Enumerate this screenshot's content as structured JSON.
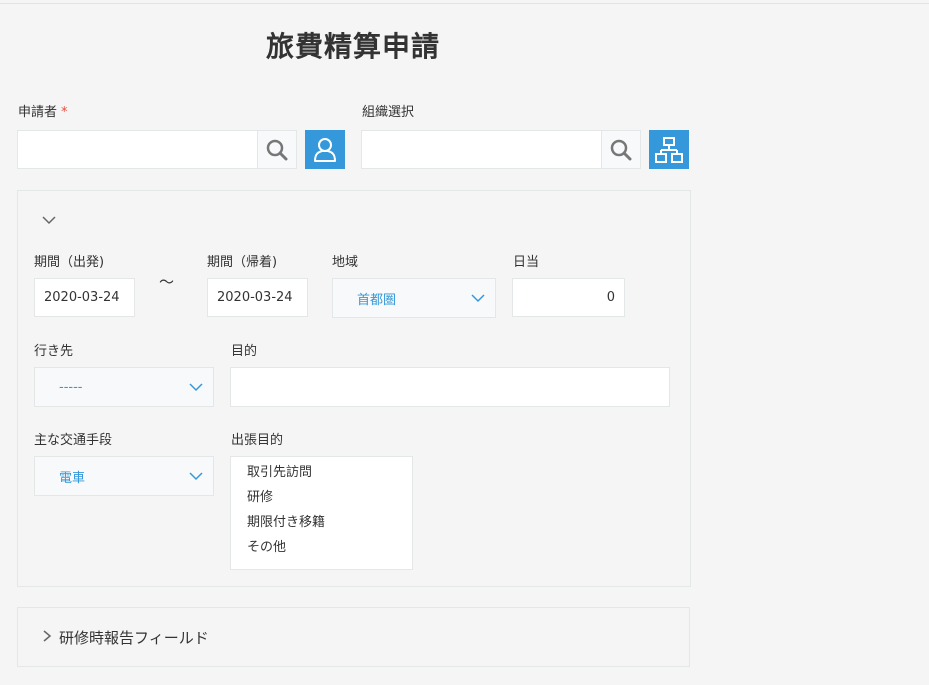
{
  "form": {
    "title": "旅費精算申請"
  },
  "applicant": {
    "label": "申請者",
    "required_mark": "*",
    "value": ""
  },
  "org": {
    "label": "組織選択",
    "value": ""
  },
  "group": {
    "period_start": {
      "label": "期間（出発)",
      "value": "2020-03-24"
    },
    "tilde": "～",
    "period_end": {
      "label": "期間（帰着)",
      "value": "2020-03-24"
    },
    "region": {
      "label": "地域",
      "value": "首都圏"
    },
    "allowance": {
      "label": "日当",
      "value": "0"
    },
    "destination": {
      "label": "行き先",
      "value": "-----"
    },
    "purpose": {
      "label": "目的",
      "value": ""
    },
    "transport": {
      "label": "主な交通手段",
      "value": "電車"
    },
    "trip_purpose": {
      "label": "出張目的",
      "options": [
        "取引先訪問",
        "研修",
        "期限付き移籍",
        "その他"
      ]
    }
  },
  "training_group": {
    "label": "研修時報告フィールド"
  },
  "colors": {
    "accent": "#3498db",
    "required": "#e74c3c"
  }
}
